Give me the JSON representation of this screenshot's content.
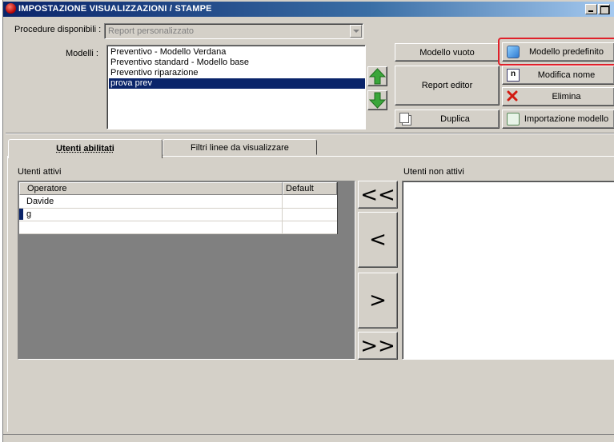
{
  "window": {
    "title": "IMPOSTAZIONE VISUALIZZAZIONI / STAMPE"
  },
  "procedure": {
    "label": "Procedure disponibili :",
    "value": "Report personalizzato"
  },
  "modelli": {
    "label": "Modelli :",
    "items": [
      "Preventivo - Modello Verdana",
      "Preventivo standard - Modello base",
      "Preventivo riparazione",
      "prova prev"
    ],
    "selected_index": 3
  },
  "buttons": {
    "modello_vuoto": "Modello vuoto",
    "modello_predefinito": "Modello predefinito",
    "report_editor": "Report editor",
    "modifica_nome": "Modifica nome",
    "elimina": "Elimina",
    "duplica": "Duplica",
    "importazione_modello": "Importazione modello"
  },
  "tabs": [
    {
      "label": "Utenti abilitati",
      "active": true
    },
    {
      "label": "Filtri linee da visualizzare",
      "active": false
    }
  ],
  "utenti_attivi": {
    "label": "Utenti attivi",
    "columns": [
      "Operatore",
      "Default"
    ],
    "rows": [
      "Davide",
      "g",
      ""
    ]
  },
  "utenti_non_attivi": {
    "label": "Utenti non attivi"
  },
  "transfer_buttons": [
    "<<",
    "<",
    ">",
    ">>"
  ],
  "colors": {
    "title_start": "#0a246a",
    "selection": "#0a246a",
    "face": "#d4d0c8",
    "highlight_border": "#e0202a",
    "arrow_green": "#3aa63a"
  }
}
